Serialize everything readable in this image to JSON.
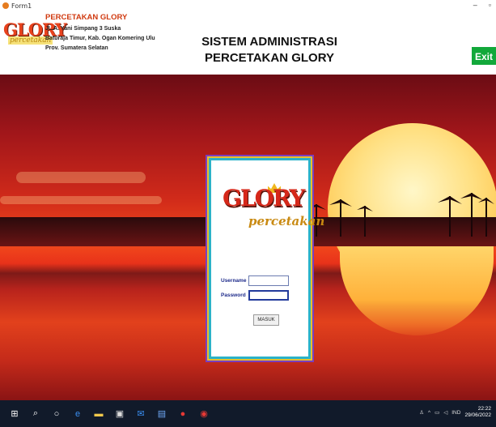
{
  "window": {
    "title": "Form1"
  },
  "header": {
    "logo_top": "GLORY",
    "logo_bottom": "percetakan",
    "company_name": "PERCETAKAN GLORY",
    "address_lines": [
      "JL.A. Yani Simpang 3 Suska",
      "Baturaja Timur, Kab. Ogan Komering Ulu",
      "Prov. Sumatera Selatan"
    ],
    "system_title_line1": "SISTEM ADMINISTRASI",
    "system_title_line2": "PERCETAKAN GLORY",
    "exit_label": "Exit"
  },
  "login": {
    "logo_top": "GLORY",
    "logo_bottom": "percetakan",
    "username_label": "Username",
    "password_label": "Password",
    "username_value": "",
    "password_value": "",
    "submit_label": "MASUK"
  },
  "taskbar": {
    "tray_lang": "IND",
    "time": "22:22",
    "date": "29/06/2022"
  },
  "colors": {
    "company_red": "#d03a10",
    "exit_green": "#12a83a",
    "card_border": "#2bb3c9",
    "taskbar": "#111a2a"
  }
}
